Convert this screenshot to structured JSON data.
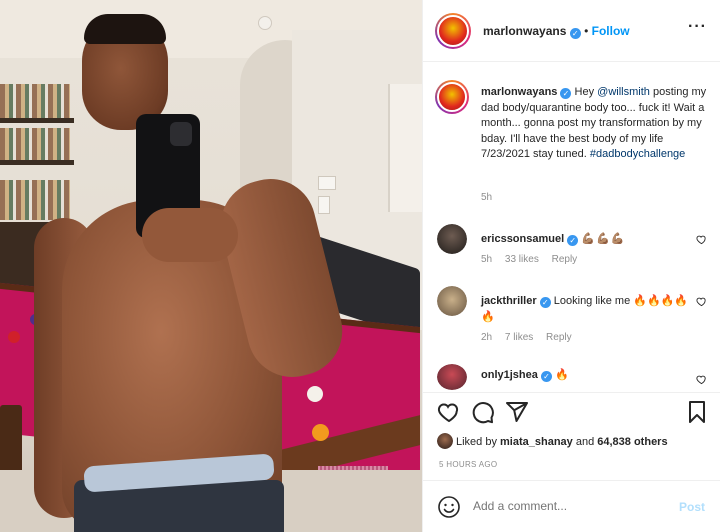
{
  "header": {
    "username": "marlonwayans",
    "follow_label": "Follow",
    "separator": "•",
    "more_label": "···"
  },
  "caption": {
    "username": "marlonwayans",
    "text_before_mention": "Hey ",
    "mention": "@willsmith",
    "text_after_mention": " posting my dad body/quarantine body too... fuck it! Wait a month... gonna post my transformation by my bday. I'll have the best body of my life 7/23/2021 stay tuned. ",
    "hashtag": "#dadbodychallenge",
    "time": "5h"
  },
  "comments": [
    {
      "username": "ericssonsamuel",
      "verified": true,
      "text": "💪🏽💪🏽💪🏽",
      "time": "5h",
      "likes": "33 likes",
      "reply": "Reply"
    },
    {
      "username": "jackthriller",
      "verified": true,
      "text": "Looking like me 🔥🔥🔥🔥🔥",
      "time": "2h",
      "likes": "7 likes",
      "reply": "Reply"
    },
    {
      "username": "only1jshea",
      "verified": true,
      "text": "🔥"
    }
  ],
  "likes": {
    "prefix": "Liked by ",
    "user": "miata_shanay",
    "middle": " and ",
    "count": "64,838 others"
  },
  "timestamp": "5 HOURS AGO",
  "add_comment": {
    "placeholder": "Add a comment...",
    "post_label": "Post"
  },
  "colors": {
    "accent": "#0095f6",
    "verified": "#3897f0",
    "link": "#00376b",
    "muted": "#8e8e8e"
  },
  "icons": [
    "verified-badge-icon",
    "heart-icon",
    "comment-icon",
    "share-icon",
    "bookmark-icon",
    "emoji-icon",
    "more-options-icon"
  ]
}
